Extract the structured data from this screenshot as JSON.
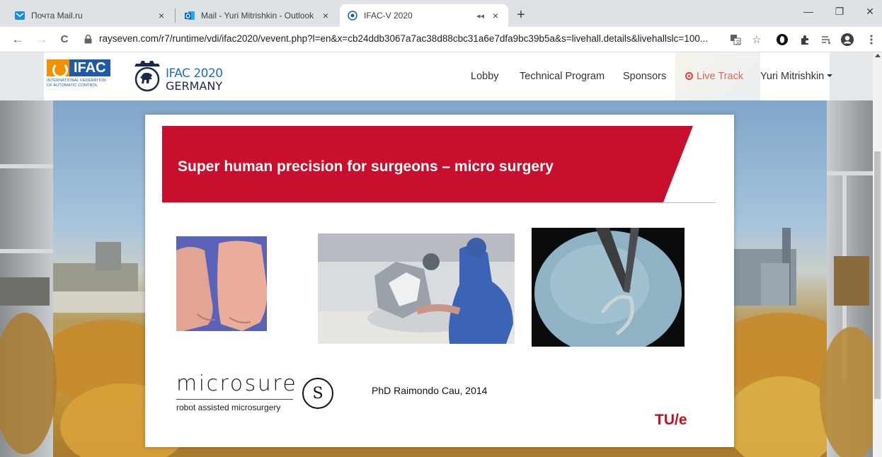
{
  "browser": {
    "tabs": [
      {
        "title": "Почта Mail.ru",
        "favicon": "mail-icon",
        "active": false
      },
      {
        "title": "Mail - Yuri Mitrishkin - Outlook",
        "favicon": "outlook-icon",
        "active": false
      },
      {
        "title": "IFAC-V 2020",
        "favicon": "ifac-icon",
        "active": true
      }
    ],
    "tab_close_glyph": "×",
    "new_tab_glyph": "+",
    "window_controls": {
      "minimize": "—",
      "restore": "❐",
      "close": "✕"
    },
    "nav": {
      "back": "←",
      "forward": "→",
      "reload": "C"
    },
    "url": "rayseven.com/r7/runtime/vdi/ifac2020/vevent.php?l=en&x=cb24ddb3067a7ac38d88cbc31a6e7dfa9bc39b5a&s=livehall.details&livehallslc=100...",
    "toolbar_icons": [
      "translate-icon",
      "bookmark-star-icon",
      "opera-icon",
      "extensions-icon",
      "reading-list-icon",
      "profile-icon",
      "menu-icon"
    ]
  },
  "site": {
    "logo": {
      "name": "IFAC",
      "subtitle_line1": "INTERNATIONAL FEDERATION",
      "subtitle_line2": "OF AUTOMATIC CONTROL"
    },
    "event_logo": {
      "line1": "IFAC 2020",
      "line2": "GERMANY"
    },
    "nav": [
      {
        "label": "Lobby"
      },
      {
        "label": "Technical Program"
      },
      {
        "label": "Sponsors"
      },
      {
        "label": "Live Track"
      }
    ],
    "user": "Yuri Mitrishkin",
    "colors": {
      "ifac_blue": "#1f5aa6",
      "ifac_orange": "#f39200",
      "live_red": "#e0423a"
    }
  },
  "slide": {
    "title": "Super human precision for surgeons – micro surgery",
    "banner_color": "#c8102e",
    "brand_word": "microsure",
    "brand_tagline": "robot assisted microsurgery",
    "brand_mark": "S",
    "author": "PhD Raimondo Cau, 2014",
    "institution": "TU/e",
    "images": [
      "lymphedema-arms-photo",
      "surgeon-robot-photo",
      "microscope-suture-photo"
    ]
  }
}
